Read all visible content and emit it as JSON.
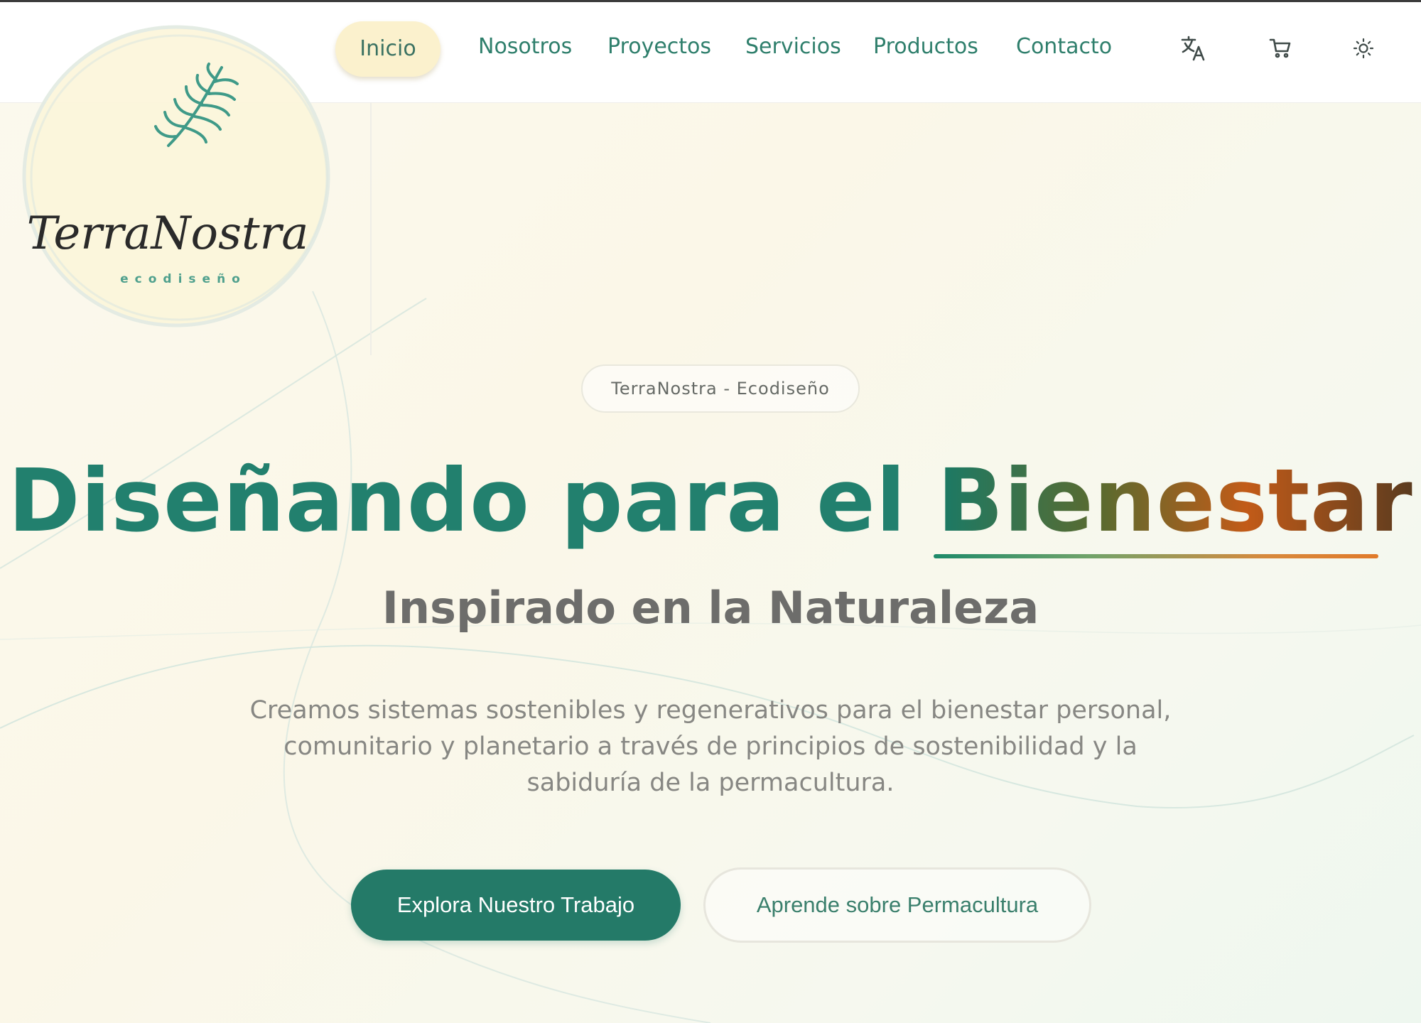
{
  "nav": {
    "items": [
      {
        "label": "Inicio",
        "active": true
      },
      {
        "label": "Nosotros"
      },
      {
        "label": "Proyectos"
      },
      {
        "label": "Servicios"
      },
      {
        "label": "Productos"
      },
      {
        "label": "Contacto"
      }
    ],
    "icons": [
      "translate-icon",
      "cart-icon",
      "sun-icon"
    ]
  },
  "logo": {
    "name": "TerraNostra",
    "tagline": "ecodiseño"
  },
  "hero": {
    "badge": "TerraNostra - Ecodiseño",
    "title_main": "Diseñando para el ",
    "title_accent": "Bienestar",
    "subtitle": "Inspirado en la Naturaleza",
    "description": "Creamos sistemas sostenibles y regenerativos para el bienestar personal, comunitario y planetario a través de principios de sostenibilidad y la sabiduría de la permacultura.",
    "primary_button": "Explora Nuestro Trabajo",
    "secondary_button": "Aprende sobre Permacultura"
  },
  "colors": {
    "brand_green": "#247a68",
    "nav_text": "#2f7f6c",
    "active_pill": "#fbf1cd",
    "accent_orange": "#e07a2a",
    "background": "#fbf8ec"
  }
}
